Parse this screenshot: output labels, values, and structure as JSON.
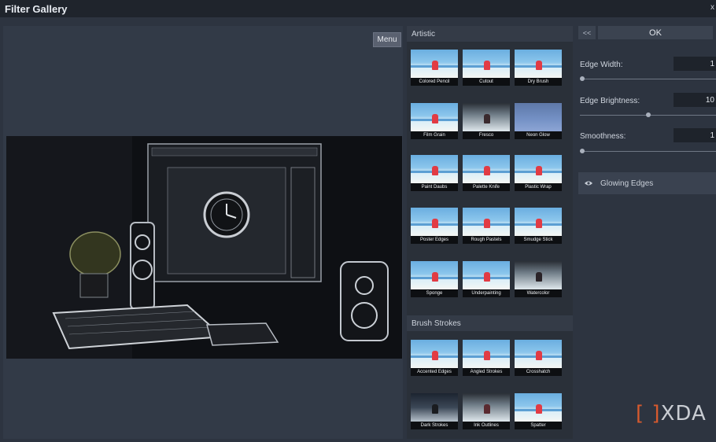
{
  "window": {
    "title": "Filter Gallery",
    "close_glyph": "x"
  },
  "preview": {
    "menu_label": "Menu"
  },
  "gallery": {
    "categories": [
      {
        "name": "Artistic",
        "filters": [
          "Colored Pencil",
          "Cutout",
          "Dry Brush",
          "Film Grain",
          "Fresco",
          "Neon Glow",
          "Paint Daubs",
          "Palette Knife",
          "Plastic Wrap",
          "Poster Edges",
          "Rough Pastels",
          "Smudge Stick",
          "Sponge",
          "Underpainting",
          "Watercolor"
        ]
      },
      {
        "name": "Brush Strokes",
        "filters": [
          "Accented Edges",
          "Angled Strokes",
          "Crosshatch",
          "Dark Strokes",
          "Ink Outlines",
          "Spatter"
        ]
      }
    ]
  },
  "settings": {
    "back_label": "<<",
    "ok_label": "OK",
    "params": [
      {
        "label": "Edge Width:",
        "value": "1",
        "level": 0.02
      },
      {
        "label": "Edge Brightness:",
        "value": "10",
        "level": 0.5
      },
      {
        "label": "Smoothness:",
        "value": "1",
        "level": 0.02
      }
    ],
    "effect_layer": {
      "name": "Glowing Edges",
      "icon": "eye-icon"
    }
  },
  "watermark": {
    "bracket": "[ ]",
    "text": "XDA"
  },
  "colors": {
    "background": "#2d3440",
    "titlebar": "#1f242c",
    "watermark_accent": "#d65a2e"
  }
}
